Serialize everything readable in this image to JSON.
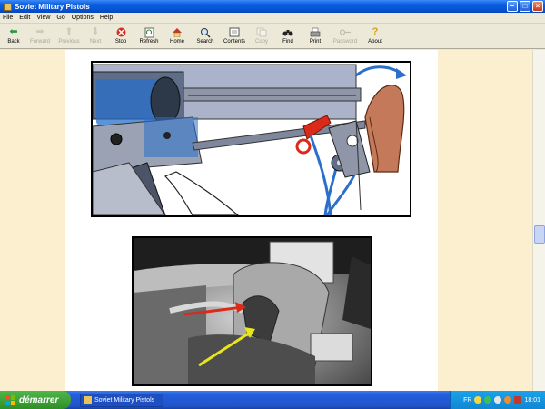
{
  "window": {
    "title": "Soviet Military Pistols"
  },
  "menu": [
    "File",
    "Edit",
    "View",
    "Go",
    "Options",
    "Help"
  ],
  "toolbar": [
    {
      "label": "Back",
      "icon": "arrow-left-icon",
      "enabled": true
    },
    {
      "label": "Forward",
      "icon": "arrow-right-icon",
      "enabled": false
    },
    {
      "label": "Previous",
      "icon": "arrow-up-icon",
      "enabled": false
    },
    {
      "label": "Next",
      "icon": "arrow-down-icon",
      "enabled": false
    },
    {
      "label": "Stop",
      "icon": "stop-icon",
      "enabled": true
    },
    {
      "label": "Refresh",
      "icon": "refresh-icon",
      "enabled": true
    },
    {
      "label": "Home",
      "icon": "home-icon",
      "enabled": true
    },
    {
      "label": "Search",
      "icon": "search-icon",
      "enabled": true
    },
    {
      "label": "Contents",
      "icon": "contents-icon",
      "enabled": true
    },
    {
      "label": "Copy",
      "icon": "copy-icon",
      "enabled": false
    },
    {
      "label": "Find",
      "icon": "binoculars-icon",
      "enabled": true
    },
    {
      "label": "Print",
      "icon": "print-icon",
      "enabled": true
    },
    {
      "label": "Password",
      "icon": "key-icon",
      "enabled": false
    },
    {
      "label": "About",
      "icon": "help-icon",
      "enabled": true
    }
  ],
  "taskbar": {
    "start_label": "démarrer",
    "task_label": "Soviet Military Pistols",
    "lang": "FR",
    "clock": "18:01"
  },
  "colors": {
    "accent_red": "#d92a1a",
    "accent_blue": "#2a6fc9",
    "arrow_yellow": "#e8e61a",
    "page_bg": "#fcefcf"
  }
}
